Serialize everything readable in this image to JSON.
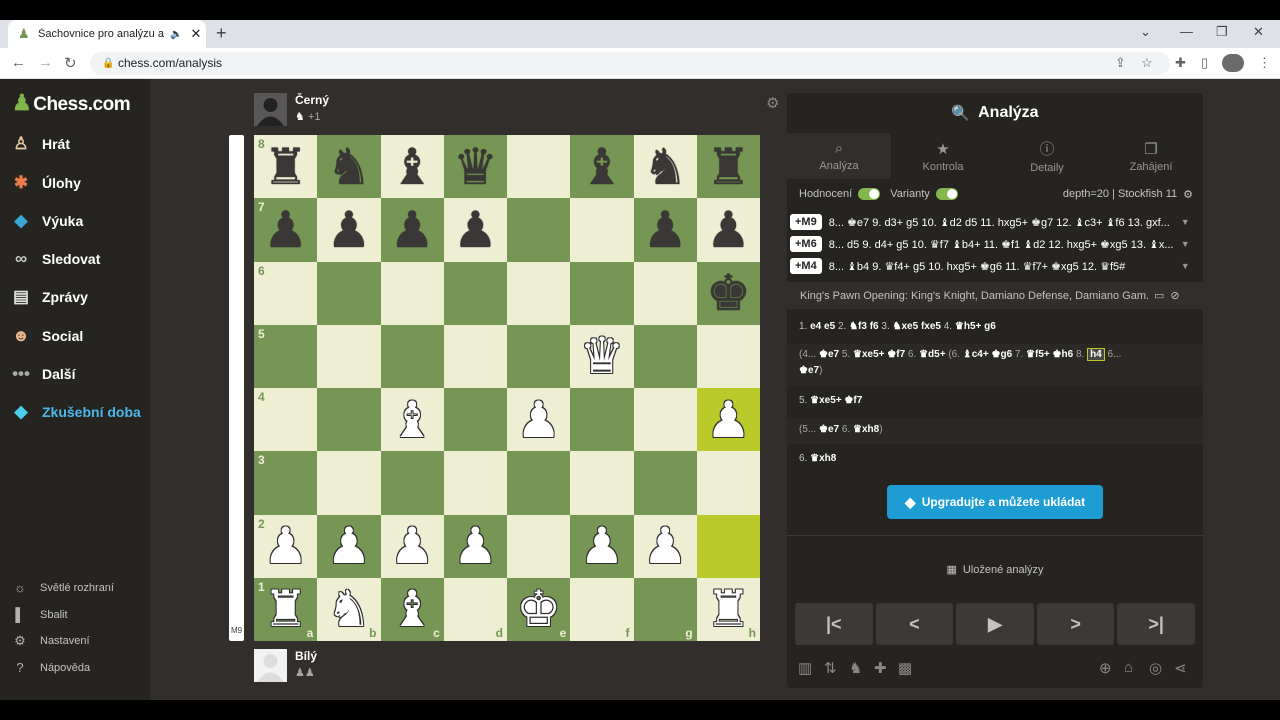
{
  "browser": {
    "tab_title": "Šachovnice pro analýzu a edi",
    "url": "chess.com/analysis",
    "minimize": "—",
    "maximize": "❐",
    "close": "✕"
  },
  "sidebar": {
    "logo": "Chess.com",
    "items": [
      {
        "label": "Hrát",
        "icon": "play-icon"
      },
      {
        "label": "Úlohy",
        "icon": "puzzle-icon"
      },
      {
        "label": "Výuka",
        "icon": "learn-icon"
      },
      {
        "label": "Sledovat",
        "icon": "watch-icon"
      },
      {
        "label": "Zprávy",
        "icon": "news-icon"
      },
      {
        "label": "Social",
        "icon": "social-icon"
      },
      {
        "label": "Další",
        "icon": "more-icon"
      },
      {
        "label": "Zkušební doba",
        "icon": "diamond-icon"
      }
    ],
    "bottom": [
      {
        "label": "Světlé rozhraní",
        "icon": "sun-icon"
      },
      {
        "label": "Sbalit",
        "icon": "collapse-icon"
      },
      {
        "label": "Nastavení",
        "icon": "settings-icon"
      },
      {
        "label": "Nápověda",
        "icon": "help-icon"
      }
    ]
  },
  "players": {
    "top": {
      "name": "Černý",
      "material": "+1"
    },
    "bottom": {
      "name": "Bílý"
    }
  },
  "eval_bar": {
    "text": "M9",
    "white_fraction": 1.0
  },
  "board": {
    "ranks": [
      "8",
      "7",
      "6",
      "5",
      "4",
      "3",
      "2",
      "1"
    ],
    "files": [
      "a",
      "b",
      "c",
      "d",
      "e",
      "f",
      "g",
      "h"
    ],
    "position": [
      [
        "br",
        "bn",
        "bb",
        "bq",
        "",
        "bb",
        "bn",
        "br"
      ],
      [
        "bp",
        "bp",
        "bp",
        "bp",
        "",
        "",
        "bp",
        "bp"
      ],
      [
        "",
        "",
        "",
        "",
        "",
        "",
        "",
        "bk"
      ],
      [
        "",
        "",
        "",
        "",
        "",
        "wq",
        "",
        ""
      ],
      [
        "",
        "",
        "wb",
        "",
        "wp",
        "",
        "",
        "wp"
      ],
      [
        "",
        "",
        "",
        "",
        "",
        "",
        "",
        ""
      ],
      [
        "wp",
        "wp",
        "wp",
        "wp",
        "",
        "wp",
        "wp",
        ""
      ],
      [
        "wr",
        "wn",
        "wb",
        "",
        "wk",
        "",
        "",
        "wr"
      ]
    ],
    "highlighted": [
      "h4",
      "h2"
    ],
    "light_color": "#eeeed2",
    "dark_color": "#769656",
    "highlight_color": "#baca2b"
  },
  "panel": {
    "title": "Analýza",
    "tabs": [
      "Analýza",
      "Kontrola",
      "Detaily",
      "Zahájení"
    ],
    "toggle_eval": "Hodnocení",
    "toggle_variants": "Varianty",
    "engine": "depth=20 | Stockfish 11",
    "lines": [
      {
        "score": "+M9",
        "moves": "8... ♚e7 9. d3+ g5 10. ♝d2 d5 11. hxg5+ ♚g7 12. ♝c3+ ♝f6 13. gxf..."
      },
      {
        "score": "+M6",
        "moves": "8... d5 9. d4+ g5 10. ♛f7 ♝b4+ 11. ♚f1 ♝d2 12. hxg5+ ♚xg5 13. ♝x..."
      },
      {
        "score": "+M4",
        "moves": "8... ♝b4 9. ♛f4+ g5 10. hxg5+ ♚g6 11. ♛f7+ ♚xg5 12. ♛f5#"
      }
    ],
    "opening": "King's Pawn Opening: King's Knight, Damiano Defense, Damiano Gam...",
    "moves": {
      "m1": "1. ",
      "m1w": "e4",
      "m1b": "e5",
      "m2": "2. ",
      "m2w": "♞f3",
      "m2b": "f6",
      "m3": "3. ",
      "m3w": "♞xe5",
      "m3b": "fxe5",
      "m4": "4. ",
      "m4w": "♛h5+",
      "m4b": "g6",
      "v1a": "(4... ",
      "v1b": "♚e7",
      "v1c": " 5. ",
      "v1d": "♛xe5+",
      "v1e": "♚f7",
      "v1f": " 6. ",
      "v1g": "♛d5+",
      "v1h": " (6. ",
      "v1i": "♝c4+",
      "v1j": "♚g6",
      "v1k": " 7. ",
      "v1l": "♛f5+",
      "v1m": "♚h6",
      "v1n": " 8. ",
      "v1o": "h4",
      "v1p": " 6...",
      "v1q": "♚e7",
      "v1r": ")",
      "m5": "5. ",
      "m5w": "♛xe5+",
      "m5b": "♚f7",
      "v2a": "(5... ",
      "v2b": "♚e7",
      "v2c": " 6. ",
      "v2d": "♛xh8",
      "v2e": ")",
      "m6": "6. ",
      "m6w": "♛xh8"
    },
    "upgrade_button": "Upgradujte a můžete ukládat",
    "saved": "Uložené analýzy"
  }
}
